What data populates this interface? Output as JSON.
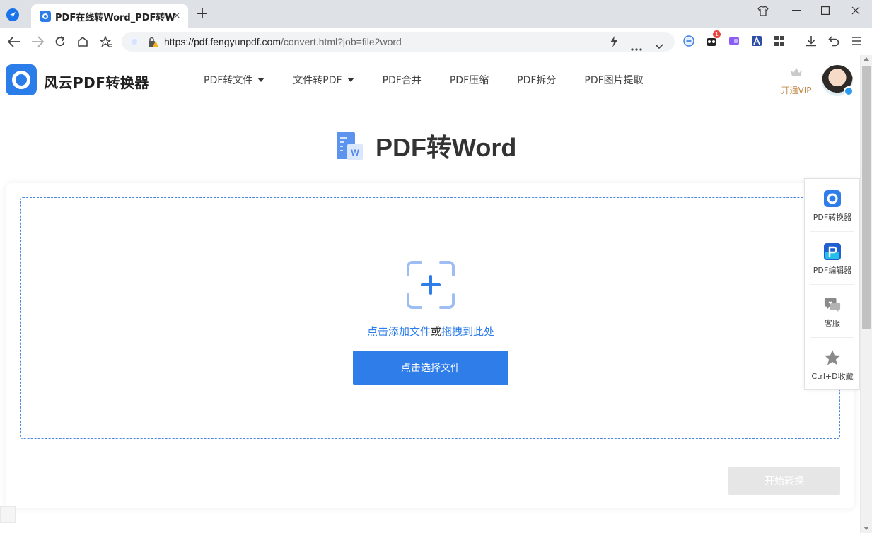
{
  "browser": {
    "tab_title": "PDF在线转Word_PDF转Word在线转换",
    "tab_close": "×",
    "new_tab": "+",
    "url_domain": "https://pdf.fengyunpdf.com",
    "url_rest": "/convert.html?job=file2word",
    "extension_badge": "1"
  },
  "site": {
    "logo_text": "风云PDF转换器",
    "nav": [
      {
        "label": "PDF转文件",
        "dropdown": true
      },
      {
        "label": "文件转PDF",
        "dropdown": true
      },
      {
        "label": "PDF合并",
        "dropdown": false
      },
      {
        "label": "PDF压缩",
        "dropdown": false
      },
      {
        "label": "PDF拆分",
        "dropdown": false
      },
      {
        "label": "PDF图片提取",
        "dropdown": false
      }
    ],
    "vip_label": "开通VIP"
  },
  "page": {
    "title": "PDF转Word",
    "doc_icon_letter": "W",
    "drop_hint_link1": "点击添加文件",
    "drop_hint_mid": "或",
    "drop_hint_link2": "拖拽到此处",
    "select_button": "点击选择文件",
    "start_button": "开始转换"
  },
  "side_panel": {
    "items": [
      {
        "label": "PDF转换器",
        "icon": "converter-icon"
      },
      {
        "label": "PDF编辑器",
        "icon": "editor-icon"
      },
      {
        "label": "客服",
        "icon": "customer-service-icon"
      },
      {
        "label": "Ctrl+D收藏",
        "icon": "star-icon"
      }
    ]
  },
  "colors": {
    "brand_blue": "#2f7de8",
    "vip_gold": "#c0894a",
    "disabled_gray": "#e6e6e6"
  }
}
